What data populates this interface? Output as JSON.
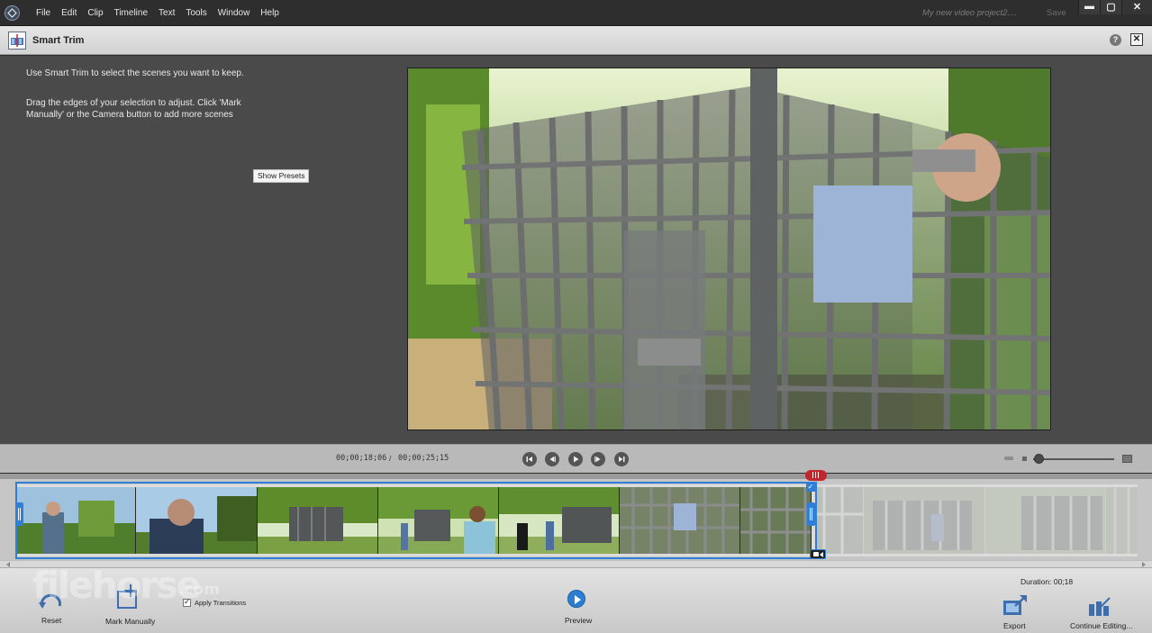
{
  "menubar": {
    "items": [
      "File",
      "Edit",
      "Clip",
      "Timeline",
      "Text",
      "Tools",
      "Window",
      "Help"
    ],
    "project_name": "My new video project2....",
    "save_label": "Save",
    "window_controls": [
      "minimize-icon",
      "maximize-icon",
      "close-icon"
    ]
  },
  "panel": {
    "title": "Smart Trim",
    "help_symbol": "?",
    "close_symbol": "✕"
  },
  "instructions": {
    "line1": "Use Smart Trim to select the scenes you want to keep.",
    "line2": "Drag the edges of your selection to adjust. Click 'Mark Manually' or the Camera button to add more scenes",
    "show_presets_label": "Show Presets"
  },
  "transport": {
    "current_time": "00;00;18;06",
    "separator": "/",
    "total_time": "00;00;25;15",
    "buttons": [
      "skip-to-start-icon",
      "step-back-icon",
      "play-icon",
      "step-forward-icon",
      "skip-to-end-icon"
    ]
  },
  "timeline": {
    "selected_clip_count": 7,
    "unselected_clip_count": 3,
    "check_symbol": "✓"
  },
  "bottombar": {
    "duration": "Duration: 00;18",
    "reset_label": "Reset",
    "mark_manually_label": "Mark Manually",
    "apply_transitions_label": "Apply Transitions",
    "preview_label": "Preview",
    "export_label": "Export",
    "continue_label": "Continue Editing..."
  },
  "watermark": {
    "text": "filehorse",
    "suffix": ".com"
  },
  "colors": {
    "selection_blue": "#2f7fd6",
    "playhead_red": "#c4262e",
    "preview_blue": "#2a7fd3"
  }
}
